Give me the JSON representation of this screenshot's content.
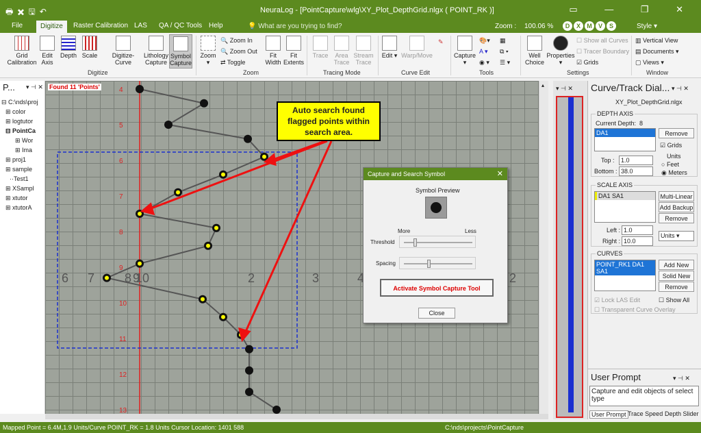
{
  "titlebar": {
    "title": "NeuraLog - [PointCapture\\wlg\\XY_Plot_DepthGrid.nlgx ( POINT_RK )]",
    "quick_access": "🖶✖🖫↶",
    "window_controls": "▭ — ❐ ✕"
  },
  "tabs": [
    "File",
    "Digitize",
    "Raster Calibration",
    "LAS",
    "QA / QC Tools",
    "Help"
  ],
  "search_placeholder": "What are you trying to find?",
  "zoom": {
    "label": "Zoom :",
    "value": "100.06 %"
  },
  "style_label": "Style",
  "ribbon_circles": [
    "D",
    "X",
    "M",
    "V",
    "S"
  ],
  "ribbon": {
    "grid_calibration": "Grid\nCalibration",
    "edit_axis": "Edit\nAxis",
    "depth": "Depth",
    "scale": "Scale",
    "digitize_curve": "Digitize-Curve",
    "lithology_capture": "Lithology\nCapture",
    "symbol_capture": "Symbol\nCapture",
    "digitize_group": "Digitize",
    "zoom": "Zoom",
    "zoom_in": "Zoom In",
    "zoom_out": "Zoom Out",
    "toggle": "Toggle",
    "fit_width": "Fit\nWidth",
    "fit_extents": "Fit\nExtents",
    "zoom_group": "Zoom",
    "trace": "Trace",
    "area_trace": "Area\nTrace",
    "stream_trace": "Stream\nTrace",
    "tracing_group": "Tracing Mode",
    "edit": "Edit",
    "warp_move": "Warp/Move",
    "curve_edit_group": "Curve Edit",
    "capture": "Capture",
    "tools_group": "Tools",
    "well_choice": "Well\nChoice",
    "properties": "Properties",
    "show_all_curves": "Show all Curves",
    "tracer_boundary": "Tracer Boundary",
    "grids": "Grids",
    "settings_group": "Settings",
    "vertical_view": "Vertical View",
    "documents": "Documents",
    "views": "Views",
    "window_group": "Window"
  },
  "left_panel": {
    "title": "P...",
    "items": [
      "C:\\nds\\proj",
      "color",
      "logtutor",
      "PointCa",
      "Wor",
      "Ima",
      "proj1",
      "sample",
      "Test1",
      "XSampl",
      "xtutor",
      "xtutorA"
    ]
  },
  "plot": {
    "found_label": "Found 11 'Points'",
    "depth_labels": [
      "4",
      "5",
      "6",
      "7",
      "8",
      "9",
      "10",
      "11",
      "12",
      "13"
    ],
    "scale_labels": [
      "6",
      "7",
      "8",
      "9",
      "10",
      "2",
      "3",
      "4",
      "2"
    ]
  },
  "callout": {
    "text": "Auto search found flagged points within search area."
  },
  "dialog": {
    "title": "Capture and Search Symbol",
    "symbol_preview": "Symbol Preview",
    "more": "More",
    "less": "Less",
    "threshold": "Threshold",
    "spacing": "Spacing",
    "activate": "Activate Symbol Capture Tool",
    "close": "Close"
  },
  "right_panel": {
    "title": "Curve/Track Dial...",
    "file": "XY_Plot_DepthGrid.nlgx",
    "depth_axis": "DEPTH AXIS",
    "current_depth_label": "Current Depth:",
    "current_depth": "8",
    "depth_item": "DA1",
    "remove": "Remove",
    "grids": "Grids",
    "top_label": "Top :",
    "top_value": "1.0",
    "bottom_label": "Bottom :",
    "bottom_value": "38.0",
    "units": "Units",
    "feet": "Feet",
    "meters": "Meters",
    "scale_axis": "SCALE AXIS",
    "scale_item": "DA1 SA1",
    "multi_linear": "Multi-Linear",
    "add_backup": "Add Backup",
    "left_label": "Left :",
    "left_value": "1.0",
    "right_label": "Right :",
    "right_value": "10.0",
    "units_select": "Units",
    "curves": "CURVES",
    "curve_item": "POINT_RK1 DA1 SA1",
    "add_new": "Add New",
    "solid_new": "Solid New",
    "lock_las": "Lock LAS Edit",
    "show_all": "Show All",
    "transparent_overlay": "Transparent Curve Overlay"
  },
  "user_prompt": {
    "title": "User Prompt",
    "text": "Capture and edit objects of select type",
    "tabs": [
      "User Prompt",
      "Trace Speed",
      "Depth Slider"
    ]
  },
  "statusbar": {
    "left": "Mapped Point = 6.4M,1.9 Units/Curve POINT_RK = 1.8 Units Cursor Location: 1401 588",
    "right": "C:\\nds\\projects\\PointCapture"
  },
  "chart_data": {
    "type": "scatter",
    "title": "",
    "points_depth": [
      4.0,
      4.4,
      5.0,
      5.4,
      5.9,
      6.4,
      6.9,
      7.5,
      7.9,
      8.4,
      8.9,
      9.3,
      9.9,
      10.4,
      10.9,
      11.3,
      11.9,
      12.5,
      13.0
    ],
    "found_count": 11,
    "colors": {
      "curve": "#555555",
      "flagged": "#ffff00",
      "depth_line": "#e02020",
      "search_box": "#1a2fd0",
      "arrow": "#ee1111"
    }
  }
}
